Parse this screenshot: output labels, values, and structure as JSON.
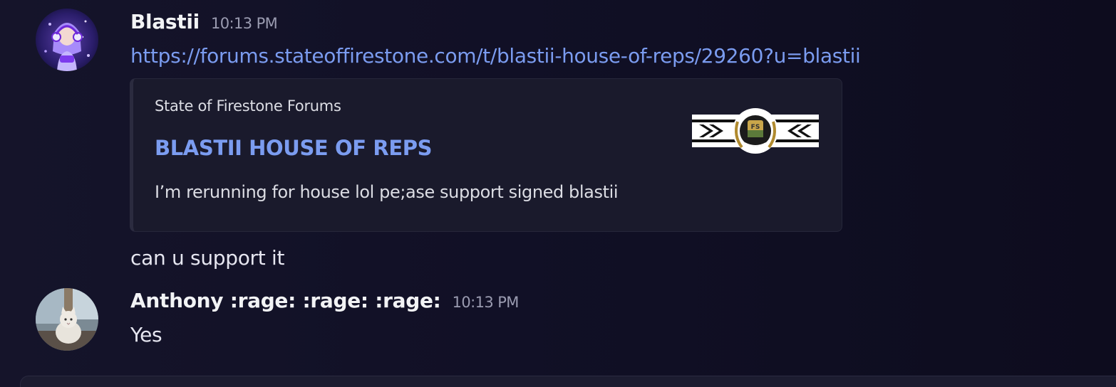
{
  "messages": [
    {
      "username": "Blastii",
      "timestamp": "10:13 PM",
      "avatar_icon": "headphones-girl-avatar",
      "link_text": "https://forums.stateoffirestone.com/t/blastii-house-of-reps/29260?u=blastii",
      "embed": {
        "provider": "State of Firestone Forums",
        "title": "BLASTII HOUSE OF REPS",
        "description": "I’m rerunning for house lol pe;ase support signed blastii",
        "thumbnail_icon": "state-of-firestone-crest",
        "thumbnail_text": "FS"
      },
      "followup": "can u support it"
    },
    {
      "username": "Anthony :rage: :rage: :rage:",
      "timestamp": "10:13 PM",
      "avatar_icon": "cat-avatar",
      "content": "Yes"
    }
  ],
  "colors": {
    "link": "#7b9cf0",
    "background": "#13122a",
    "embed_background": "#1a1a2c"
  }
}
